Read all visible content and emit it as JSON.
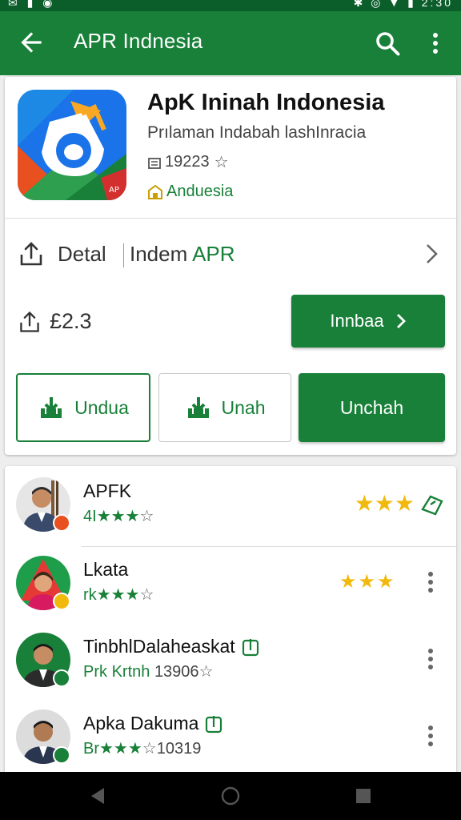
{
  "status_bar": {
    "left_icons": "✉ ▮ ◉",
    "right_icons": "✱ ◎ ▼ ▮",
    "time": "2:30"
  },
  "app_bar": {
    "title": "APR Indnesia",
    "back_icon": "arrow-back-icon",
    "search_icon": "search-icon",
    "more_icon": "more-vert-icon",
    "color": "#188038"
  },
  "app": {
    "name": "ApK Ininah Indonesia",
    "subtitle": "Prılaman Indabah lashInracia",
    "downloads": "19223",
    "tag": "Anduesia",
    "icon": "app-logo-icon"
  },
  "detail": {
    "label": "Detal",
    "value_prefix": "Indem",
    "value_suffix": "APR"
  },
  "size": {
    "value": "£2.3"
  },
  "install_button": {
    "label": "Innbaa"
  },
  "action_buttons": [
    {
      "label": "Undua"
    },
    {
      "label": "Unah"
    },
    {
      "label": "Unchah"
    }
  ],
  "reviews": [
    {
      "name": "APFK",
      "rating_prefix": "4I",
      "stars": "★★★",
      "empty": "☆",
      "count": "",
      "badge_color": "#e8501f"
    },
    {
      "name": "Lkata",
      "rating_prefix": "rk",
      "stars": "★★★",
      "empty": "☆",
      "count": "",
      "badge_color": "#f2b90d"
    },
    {
      "name": "TinbhlDalaheaskat",
      "rating_prefix": "Prk ",
      "stars": "Krtnh",
      "empty": "☆",
      "count": "13906",
      "badge_color": "#188038"
    },
    {
      "name": "Apka Dakuma",
      "rating_prefix": "Br",
      "stars": "★★★",
      "empty": "☆",
      "count": "10319",
      "badge_color": "#188038"
    }
  ],
  "nav_bar": {
    "back": "nav-back-icon",
    "home": "nav-home-icon",
    "recents": "nav-recents-icon"
  }
}
